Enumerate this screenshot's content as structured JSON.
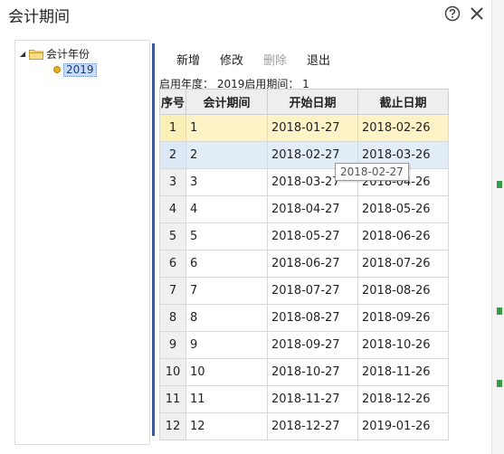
{
  "dialog": {
    "title": "会计期间",
    "help_icon": "help-circle-icon",
    "close_icon": "close-icon"
  },
  "tree": {
    "root_label": "会计年份",
    "root_icon": "folder-icon",
    "children": [
      {
        "label": "2019",
        "icon": "yellow-dot-icon",
        "selected": true
      }
    ]
  },
  "toolbar": {
    "add_label": "新增",
    "edit_label": "修改",
    "delete_label": "删除",
    "exit_label": "退出"
  },
  "info": {
    "text": "启用年度： 2019启用期间： 1"
  },
  "table": {
    "headers": [
      "序号",
      "会计期间",
      "开始日期",
      "截止日期"
    ],
    "rows": [
      [
        "1",
        "1",
        "2018-01-27",
        "2018-02-26"
      ],
      [
        "2",
        "2",
        "2018-02-27",
        "2018-03-26"
      ],
      [
        "3",
        "3",
        "2018-03-27",
        "2018-04-26"
      ],
      [
        "4",
        "4",
        "2018-04-27",
        "2018-05-26"
      ],
      [
        "5",
        "5",
        "2018-05-27",
        "2018-06-26"
      ],
      [
        "6",
        "6",
        "2018-06-27",
        "2018-07-26"
      ],
      [
        "7",
        "7",
        "2018-07-27",
        "2018-08-26"
      ],
      [
        "8",
        "8",
        "2018-08-27",
        "2018-09-26"
      ],
      [
        "9",
        "9",
        "2018-09-27",
        "2018-10-26"
      ],
      [
        "10",
        "10",
        "2018-10-27",
        "2018-11-26"
      ],
      [
        "11",
        "11",
        "2018-11-27",
        "2018-12-26"
      ],
      [
        "12",
        "12",
        "2018-12-27",
        "2019-01-26"
      ]
    ]
  },
  "tooltip": {
    "text": "2018-02-27"
  },
  "colors": {
    "selected_row": "#fdf3c6",
    "hover_row": "#e2edf8",
    "splitter": "#3b5a9a",
    "header_bg": "#eeeeee"
  }
}
